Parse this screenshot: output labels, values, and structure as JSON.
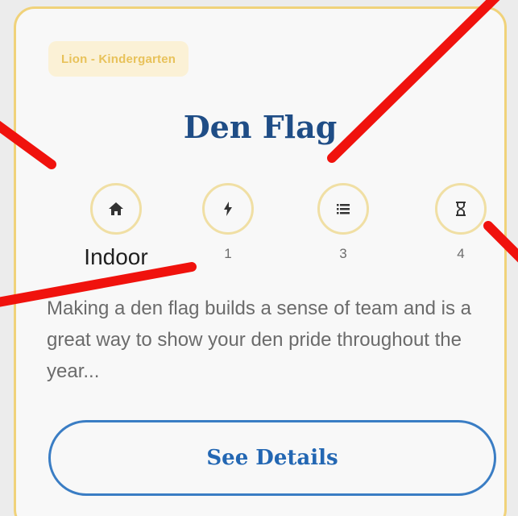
{
  "card": {
    "rank_badge": "Lion - Kindergarten",
    "title": "Den Flag",
    "stats": [
      {
        "icon": "home-icon",
        "value": "Indoor"
      },
      {
        "icon": "lightning-icon",
        "value": "1"
      },
      {
        "icon": "list-icon",
        "value": "3"
      },
      {
        "icon": "hourglass-icon",
        "value": "4"
      }
    ],
    "description": "Making a den flag builds a sense of team and is a great way to show your den pride throughout the year...",
    "button_label": "See Details"
  },
  "colors": {
    "card_border": "#f0d27a",
    "badge_background": "#fbf1d6",
    "badge_text": "#e8c25a",
    "title": "#1f4d86",
    "button_border": "#3a7dc4",
    "annotation_red": "#f0120d"
  }
}
